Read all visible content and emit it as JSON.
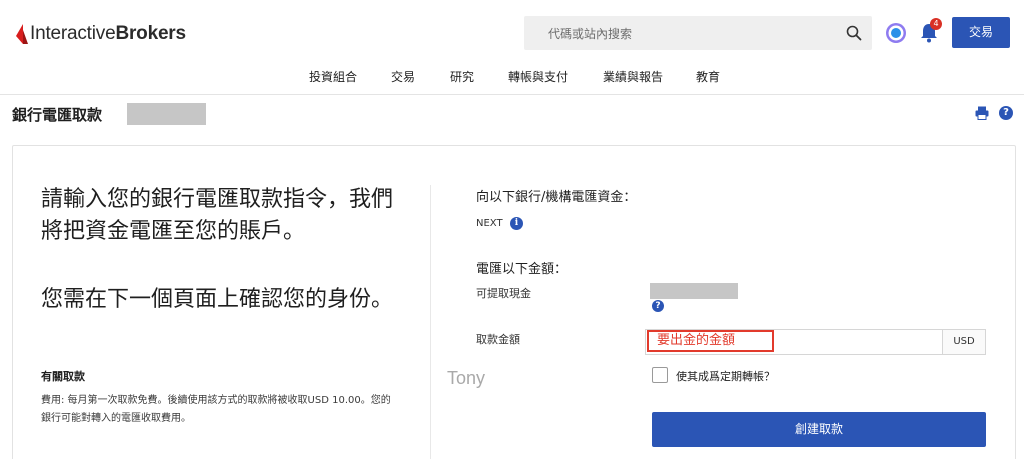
{
  "header": {
    "logo": {
      "brand_light": "Interactive",
      "brand_bold": "Brokers"
    },
    "search": {
      "placeholder": "代碼或站內搜索",
      "icon": "search-icon"
    },
    "notifications": {
      "count": "4"
    },
    "trade_button": "交易"
  },
  "nav": {
    "items": [
      {
        "label": "投資組合"
      },
      {
        "label": "交易"
      },
      {
        "label": "研究"
      },
      {
        "label": "轉帳與支付"
      },
      {
        "label": "業績與報告"
      },
      {
        "label": "教育"
      }
    ]
  },
  "page": {
    "title": "銀行電匯取款",
    "print_icon": "print-icon",
    "help_icon": "?"
  },
  "left": {
    "intro_line1": "請輸入您的銀行電匯取款指令，我們將把資金電匯至您的賬戶。",
    "intro_line2": "您需在下一個頁面上確認您的身份。",
    "about_heading": "有關取款",
    "fee_text": "費用: 每月第一次取款免費。後續使用該方式的取款將被收取USD 10.00。您的銀行可能對轉入的電匯收取費用。"
  },
  "signature": "Tony",
  "right": {
    "wire_to_label": "向以下銀行/機構電匯資金：",
    "bank_name": "NEXT",
    "info_icon": "i",
    "wire_amount_label": "電匯以下金額：",
    "available_cash_label": "可提取現金",
    "withdraw_amount_label": "取款金額",
    "amount_annotation": "要出金的金額",
    "currency": "USD",
    "recurring_label": "使其成爲定期轉帳？",
    "create_button": "創建取款"
  },
  "colors": {
    "primary_blue": "#2b55b5",
    "brand_red": "#d81e1e",
    "annotation_red": "#e23a2c",
    "badge_red": "#d93025"
  }
}
